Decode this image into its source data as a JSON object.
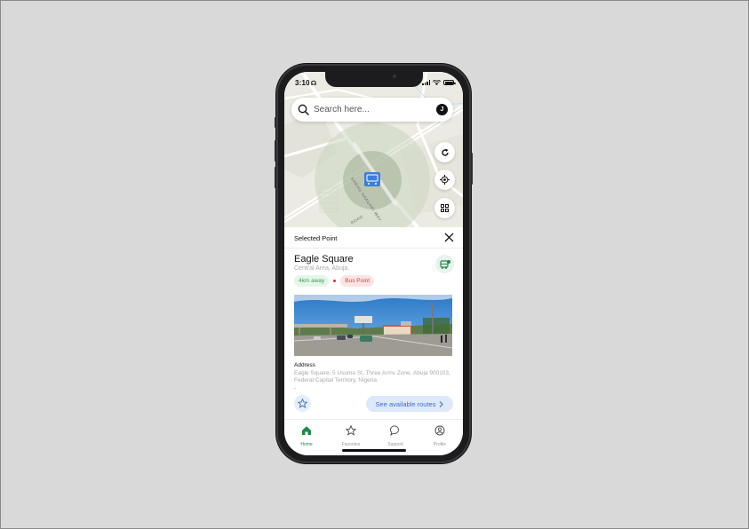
{
  "status_bar": {
    "time": "3:10"
  },
  "search": {
    "placeholder": "Search here...",
    "avatar_initial": "J"
  },
  "map": {
    "road_labels": [
      "SHEHU SHAGARI WAY",
      "ROAD"
    ],
    "controls": [
      "refresh-icon",
      "locate-icon",
      "grid-icon"
    ]
  },
  "sheet": {
    "title": "Selected Point",
    "place": {
      "name": "Eagle Square",
      "area": "Central Area, Abuja.",
      "distance": "4km away",
      "type": "Bus Point"
    },
    "address_label": "Address",
    "address_text": "Eagle Square, 5 Usuma St, Three Arms Zone, Abuja 900103, Federal Capital Territory, Nigeria",
    "address_extra": "-",
    "routes_button": "See available routes"
  },
  "tabs": [
    {
      "label": "Home",
      "icon": "home-icon",
      "active": true
    },
    {
      "label": "Favorites",
      "icon": "star-icon",
      "active": false
    },
    {
      "label": "Support",
      "icon": "chat-icon",
      "active": false
    },
    {
      "label": "Profile",
      "icon": "user-icon",
      "active": false
    }
  ],
  "colors": {
    "accent_green": "#1f8a46",
    "route_blue": "#3e6fc9",
    "bus_point_red": "#d94141",
    "distance_green": "#3f9a52",
    "map_marker_blue": "#3d7ed8"
  }
}
